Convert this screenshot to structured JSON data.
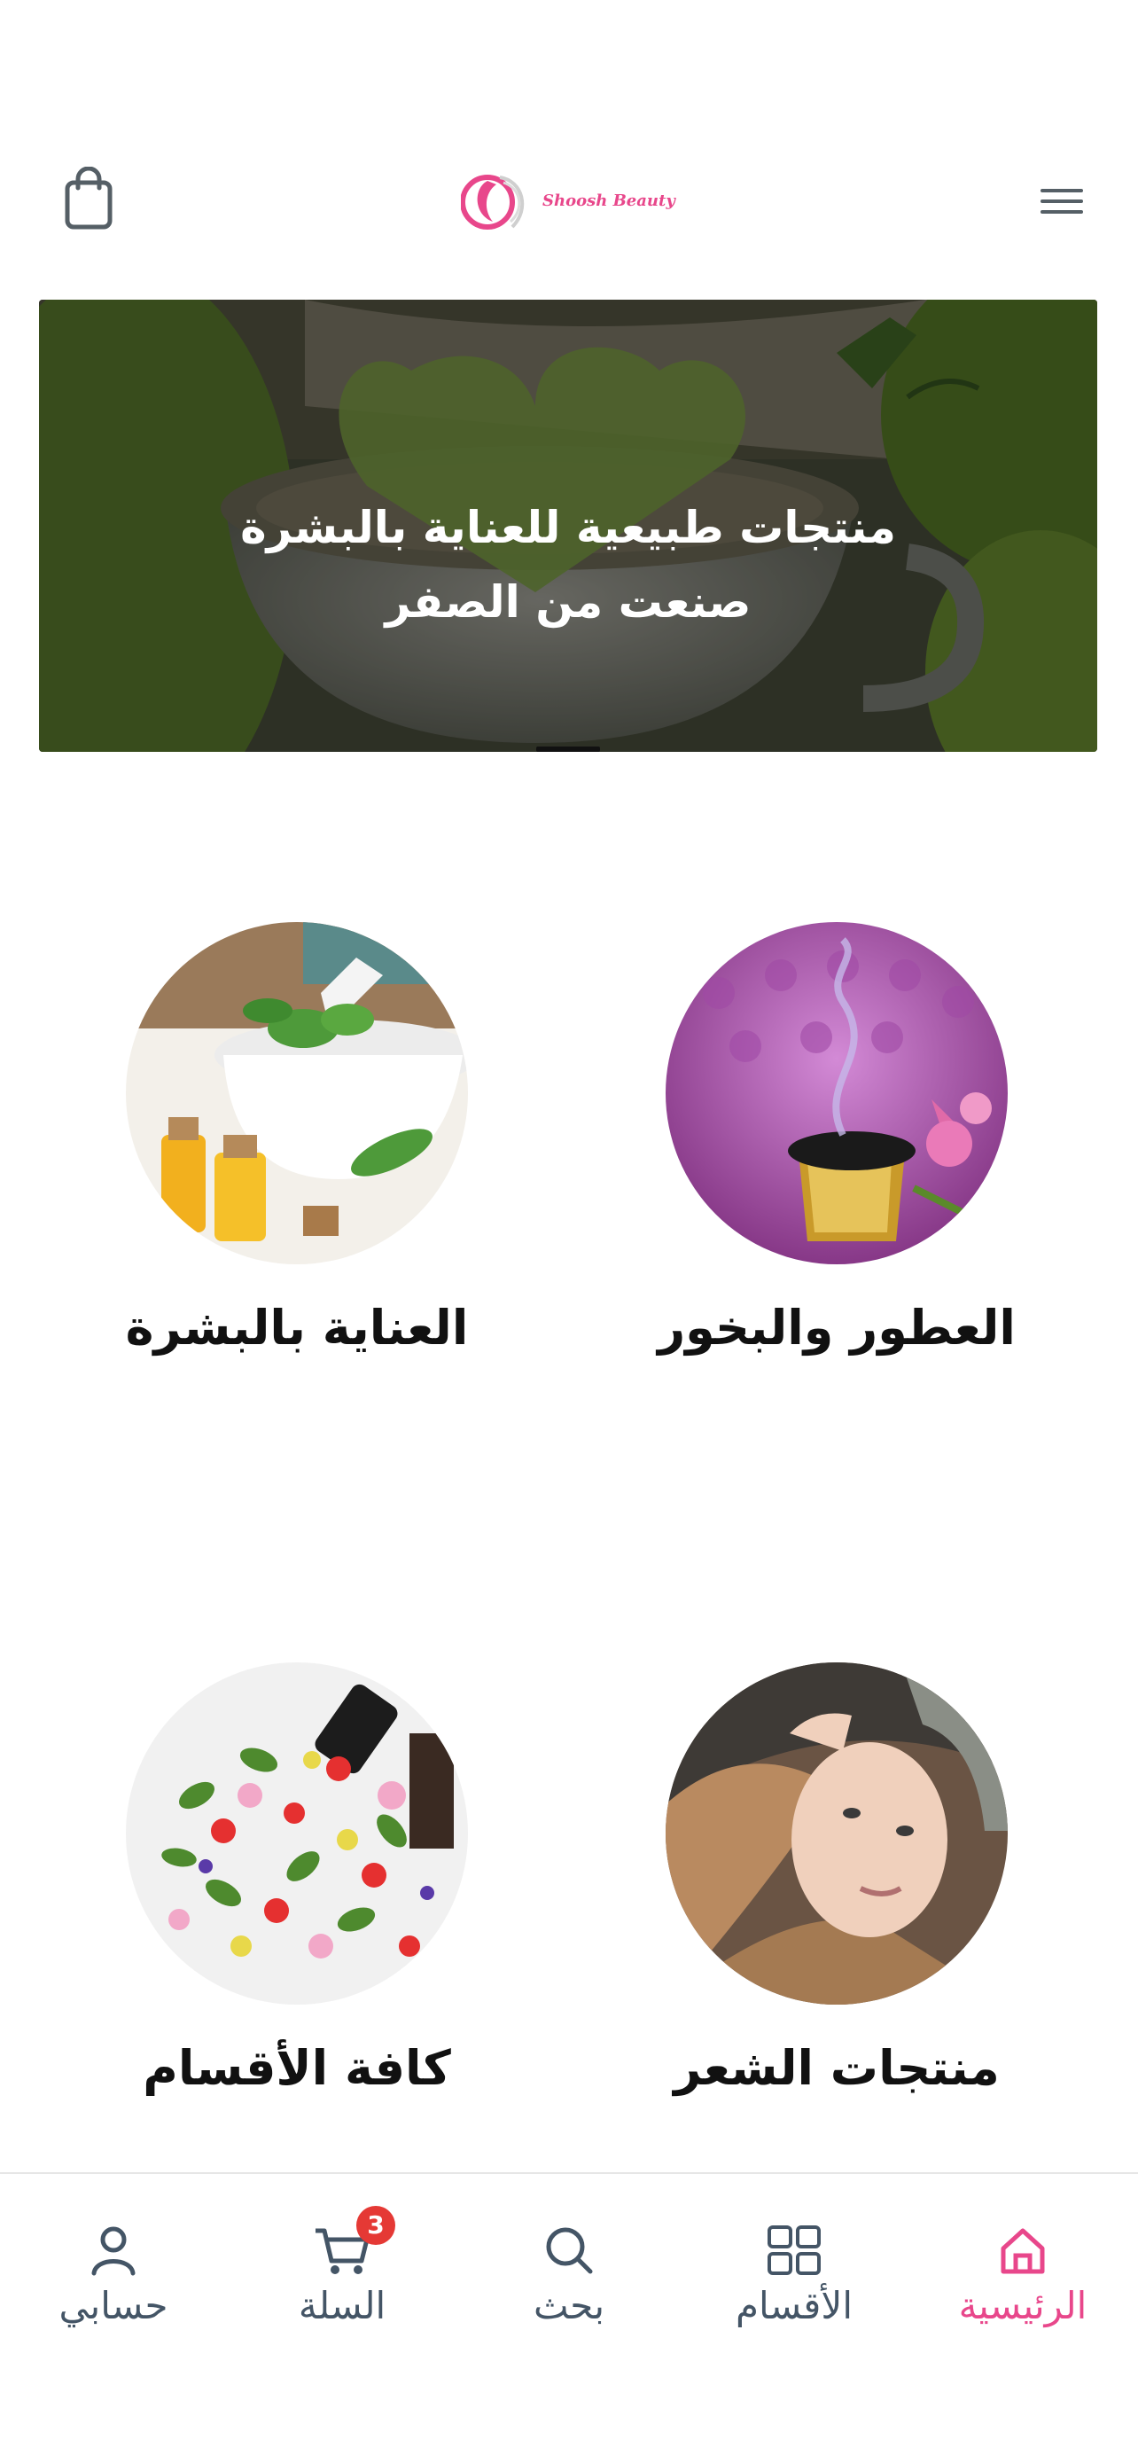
{
  "header": {
    "logo_text": "Shoosh Beauty",
    "cart_icon": "shopping-bag-icon",
    "menu_icon": "hamburger-menu-icon"
  },
  "hero": {
    "line1": "منتجات طبيعية للعناية بالبشرة",
    "line2": "صنعت من الصفر"
  },
  "categories": [
    {
      "label": "العطور والبخور"
    },
    {
      "label": "العناية بالبشرة"
    },
    {
      "label": "منتجات الشعر"
    },
    {
      "label": "كافة الأقسام"
    }
  ],
  "bottom_nav": {
    "items": [
      {
        "label": "الرئيسية",
        "icon": "home-icon",
        "active": true
      },
      {
        "label": "الأقسام",
        "icon": "grid-icon"
      },
      {
        "label": "بحث",
        "icon": "search-icon"
      },
      {
        "label": "السلة",
        "icon": "cart-icon",
        "badge": "3"
      },
      {
        "label": "حسابي",
        "icon": "user-icon"
      }
    ]
  },
  "colors": {
    "accent": "#e8478b",
    "nav_text": "#445566",
    "badge": "#e53935"
  }
}
